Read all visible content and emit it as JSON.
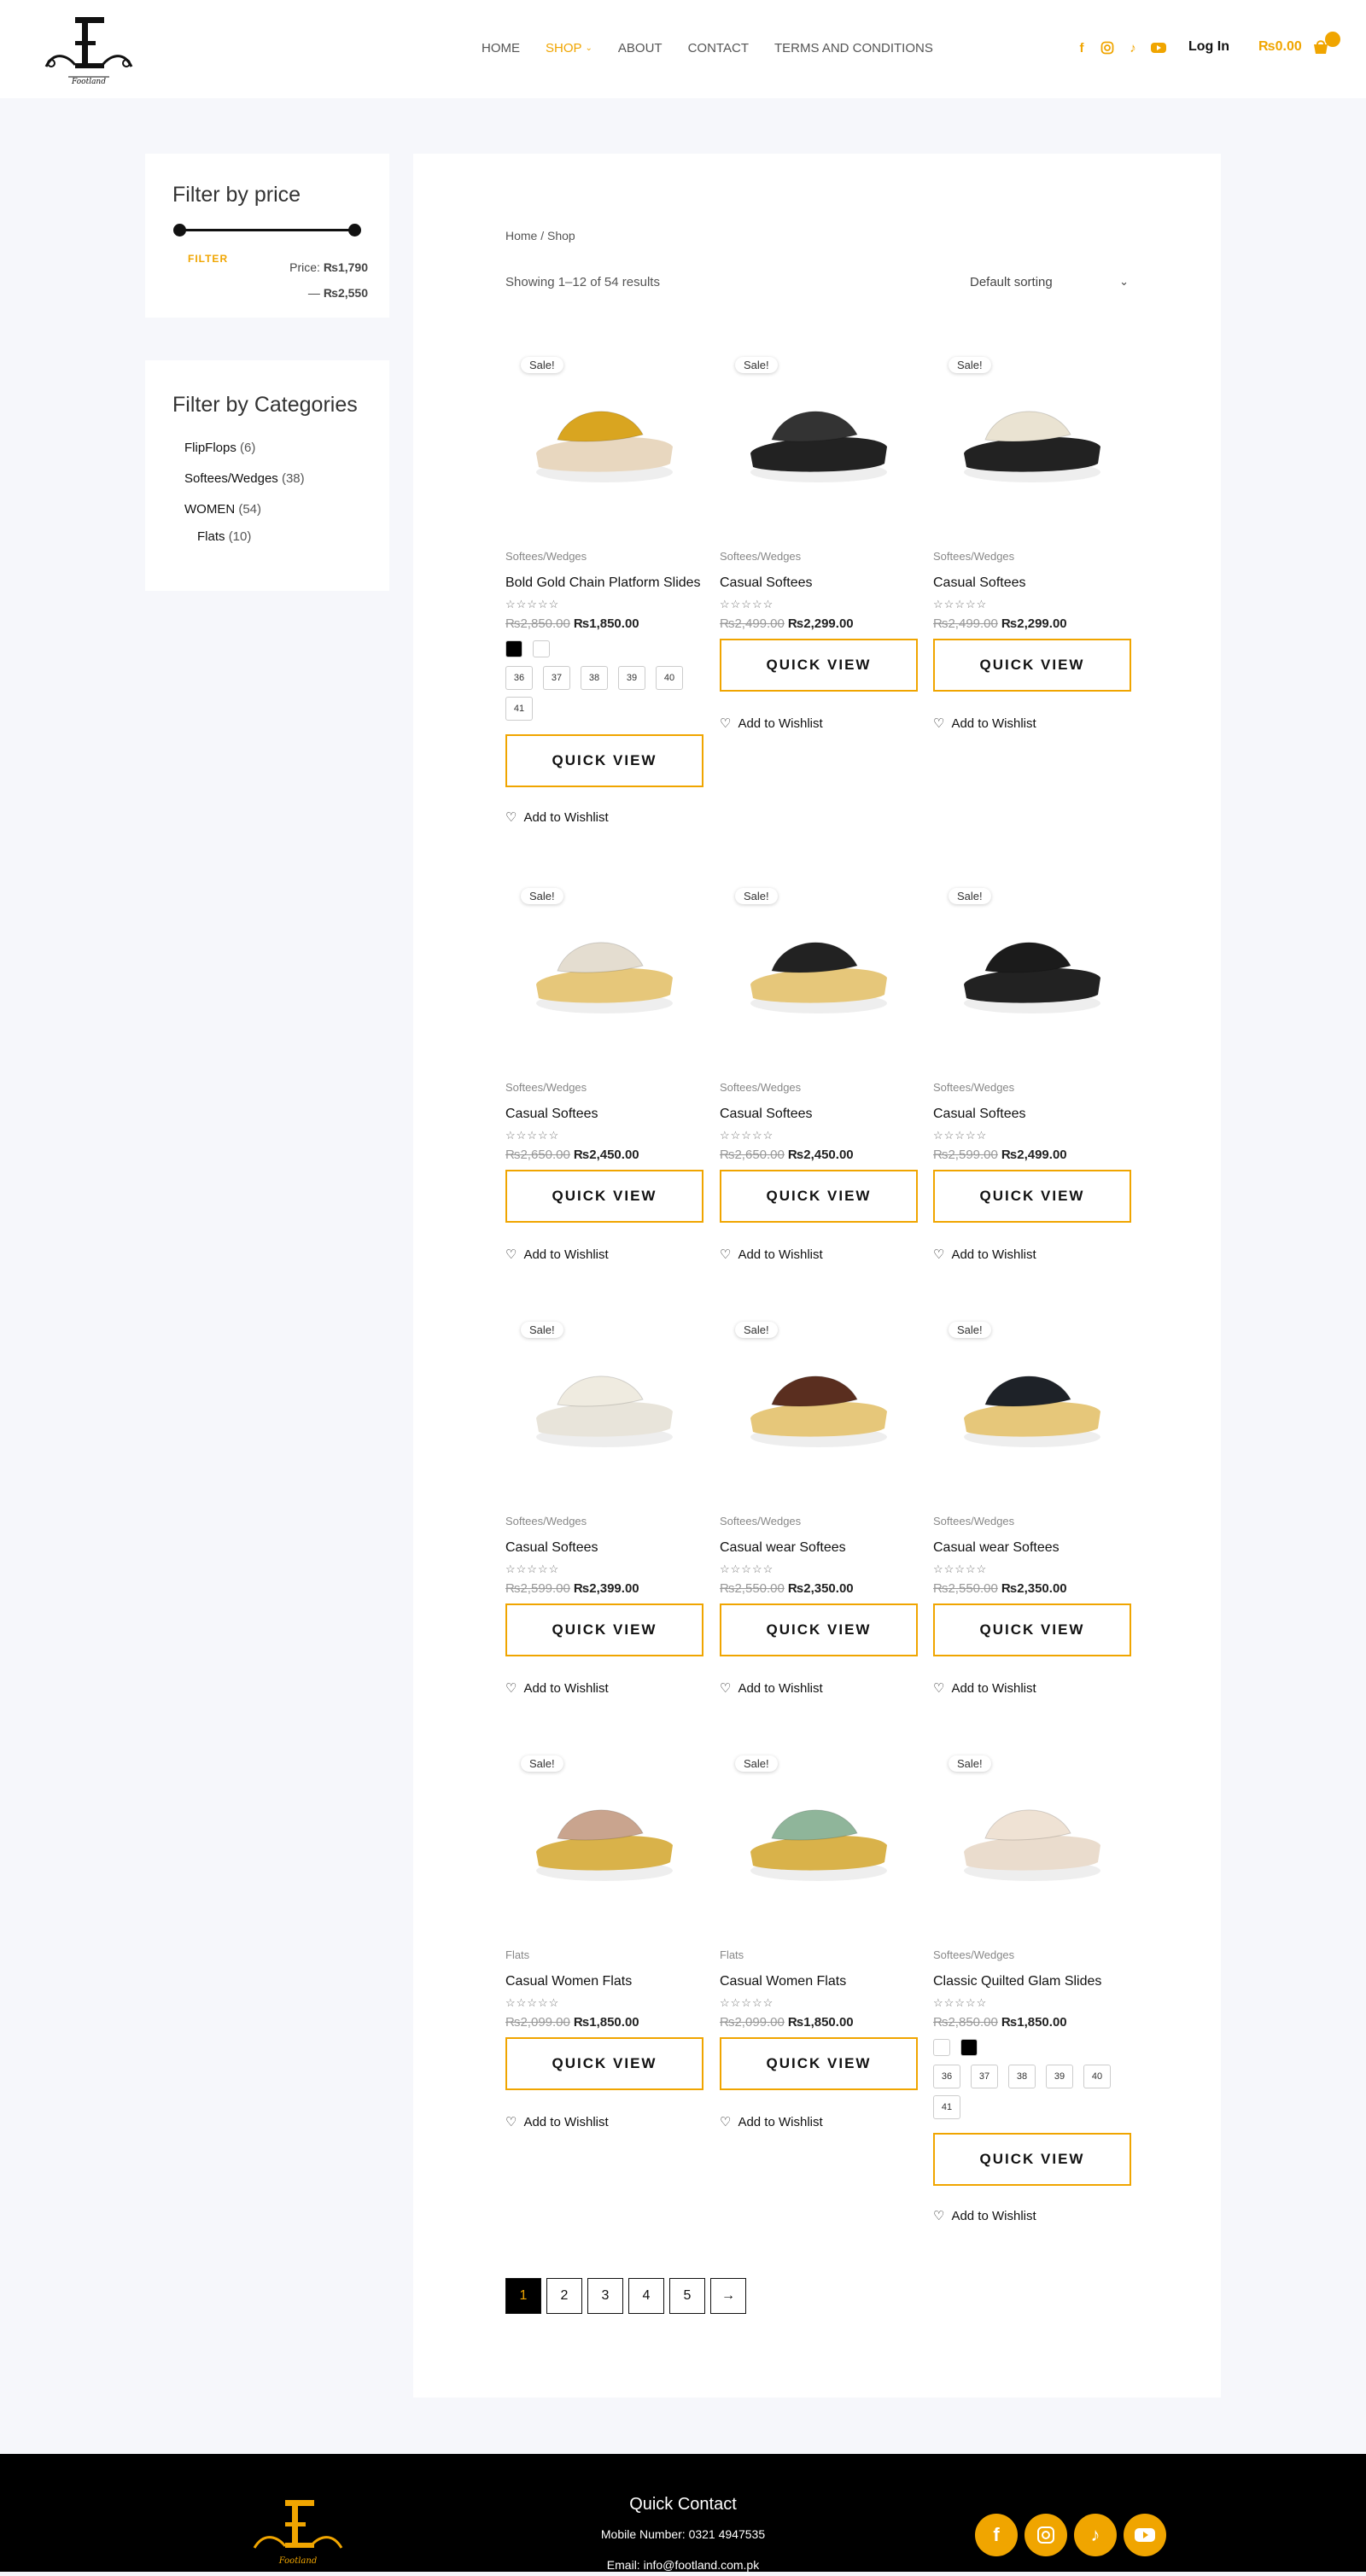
{
  "header": {
    "nav": [
      {
        "label": "HOME",
        "active": false
      },
      {
        "label": "SHOP",
        "active": true,
        "dropdown": true
      },
      {
        "label": "ABOUT",
        "active": false
      },
      {
        "label": "CONTACT",
        "active": false
      },
      {
        "label": "TERMS AND CONDITIONS",
        "active": false
      }
    ],
    "social": [
      "facebook-icon",
      "instagram-icon",
      "tiktok-icon",
      "youtube-icon"
    ],
    "login": "Log In",
    "cart_total": "₨0.00",
    "accent": "#f0a500"
  },
  "sidebar": {
    "price_title": "Filter by price",
    "filter_label": "FILTER",
    "price_prefix": "Price:",
    "price_min": "₨1,790",
    "price_max": "₨2,550",
    "categories_title": "Filter by Categories",
    "categories": [
      {
        "name": "FlipFlops",
        "count": "(6)"
      },
      {
        "name": "Softees/Wedges",
        "count": "(38)"
      },
      {
        "name": "WOMEN",
        "count": "(54)"
      },
      {
        "name": "Flats",
        "count": "(10)"
      }
    ]
  },
  "shop": {
    "breadcrumb": "Home / Shop",
    "result_count": "Showing 1–12 of 54 results",
    "sorting": "Default sorting",
    "sale_label": "Sale!",
    "stars": "☆☆☆☆☆",
    "quick_view": "QUICK VIEW",
    "wishlist": "Add to Wishlist",
    "products": [
      {
        "category": "Softees/Wedges",
        "title": "Bold Gold Chain Platform Slides",
        "old": "₨2,850.00",
        "new": "₨1,850.00",
        "swatches": [
          "#000000",
          "#ffffff"
        ],
        "sizes": [
          "36",
          "37",
          "38",
          "39",
          "40",
          "41"
        ],
        "sole": "#e8d7bf",
        "strap": "#d9a520"
      },
      {
        "category": "Softees/Wedges",
        "title": "Casual Softees",
        "old": "₨2,499.00",
        "new": "₨2,299.00",
        "sole": "#222222",
        "strap": "#333333"
      },
      {
        "category": "Softees/Wedges",
        "title": "Casual Softees",
        "old": "₨2,499.00",
        "new": "₨2,299.00",
        "sole": "#222222",
        "strap": "#eae3d2"
      },
      {
        "category": "Softees/Wedges",
        "title": "Casual Softees",
        "old": "₨2,650.00",
        "new": "₨2,450.00",
        "sole": "#e6c77a",
        "strap": "#e4ddd0"
      },
      {
        "category": "Softees/Wedges",
        "title": "Casual Softees",
        "old": "₨2,650.00",
        "new": "₨2,450.00",
        "sole": "#e6c77a",
        "strap": "#222222"
      },
      {
        "category": "Softees/Wedges",
        "title": "Casual Softees",
        "old": "₨2,599.00",
        "new": "₨2,499.00",
        "sole": "#222222",
        "strap": "#1b1b1b"
      },
      {
        "category": "Softees/Wedges",
        "title": "Casual Softees",
        "old": "₨2,599.00",
        "new": "₨2,399.00",
        "sole": "#e8e4da",
        "strap": "#efebe0"
      },
      {
        "category": "Softees/Wedges",
        "title": "Casual wear Softees",
        "old": "₨2,550.00",
        "new": "₨2,350.00",
        "sole": "#e6c77a",
        "strap": "#5a2e1f"
      },
      {
        "category": "Softees/Wedges",
        "title": "Casual wear Softees",
        "old": "₨2,550.00",
        "new": "₨2,350.00",
        "sole": "#e6c77a",
        "strap": "#1e2228"
      },
      {
        "category": "Flats",
        "title": "Casual Women Flats",
        "old": "₨2,099.00",
        "new": "₨1,850.00",
        "sole": "#d9b24a",
        "strap": "#c9a48e"
      },
      {
        "category": "Flats",
        "title": "Casual Women Flats",
        "old": "₨2,099.00",
        "new": "₨1,850.00",
        "sole": "#d9b24a",
        "strap": "#8fb59a"
      },
      {
        "category": "Softees/Wedges",
        "title": "Classic Quilted Glam Slides",
        "old": "₨2,850.00",
        "new": "₨1,850.00",
        "swatches": [
          "#ffffff",
          "#000000"
        ],
        "sizes": [
          "36",
          "37",
          "38",
          "39",
          "40",
          "41"
        ],
        "sole": "#eadccd",
        "strap": "#efe2d4"
      }
    ],
    "pages": [
      "1",
      "2",
      "3",
      "4",
      "5",
      "→"
    ]
  },
  "footer": {
    "quick_contact": "Quick Contact",
    "mobile": "Mobile Number: 0321 4947535",
    "email": "Email: info@footland.com.pk",
    "social": [
      "facebook-icon",
      "instagram-icon",
      "tiktok-icon",
      "youtube-icon"
    ]
  }
}
